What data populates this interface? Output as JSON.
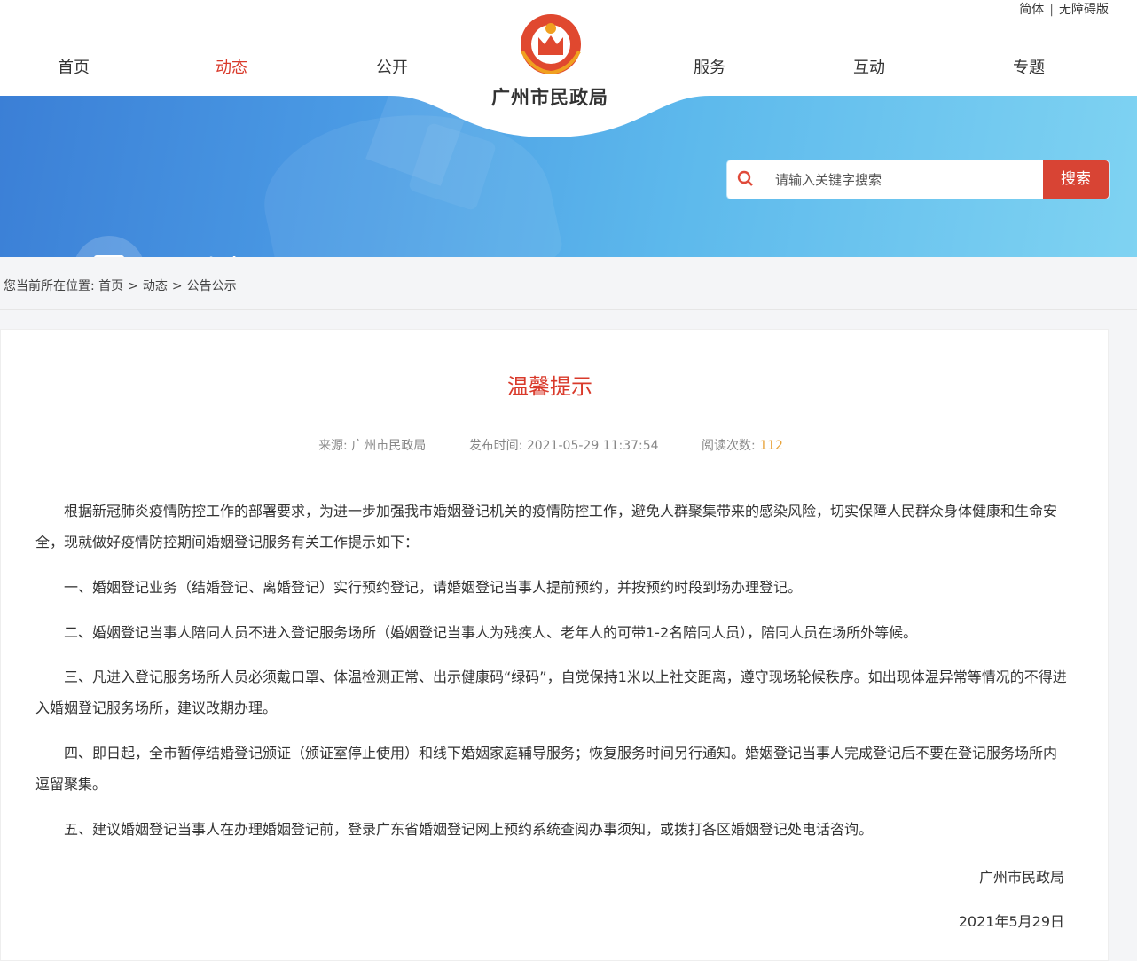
{
  "top_links": {
    "simplified": "简体",
    "accessible": "无障碍版"
  },
  "nav": {
    "items": [
      "首页",
      "动态",
      "公开",
      "服务",
      "互动",
      "专题"
    ],
    "active": 1
  },
  "logo": {
    "title": "广州市民政局"
  },
  "banner": {
    "section_title": "动态"
  },
  "search": {
    "placeholder": "请输入关键字搜索",
    "button": "搜索"
  },
  "breadcrumb": {
    "label": "您当前所在位置:",
    "items": [
      "首页",
      "动态",
      "公告公示"
    ]
  },
  "article": {
    "title": "温馨提示",
    "meta": {
      "source_label": "来源:",
      "source": "广州市民政局",
      "time_label": "发布时间:",
      "time": "2021-05-29 11:37:54",
      "views_label": "阅读次数:",
      "views": "112"
    },
    "paragraphs": [
      "根据新冠肺炎疫情防控工作的部署要求，为进一步加强我市婚姻登记机关的疫情防控工作，避免人群聚集带来的感染风险，切实保障人民群众身体健康和生命安全，现就做好疫情防控期间婚姻登记服务有关工作提示如下：",
      "一、婚姻登记业务（结婚登记、离婚登记）实行预约登记，请婚姻登记当事人提前预约，并按预约时段到场办理登记。",
      "二、婚姻登记当事人陪同人员不进入登记服务场所（婚姻登记当事人为残疾人、老年人的可带1-2名陪同人员），陪同人员在场所外等候。",
      "三、凡进入登记服务场所人员必须戴口罩、体温检测正常、出示健康码“绿码”，自觉保持1米以上社交距离，遵守现场轮候秩序。如出现体温异常等情况的不得进入婚姻登记服务场所，建议改期办理。",
      "四、即日起，全市暂停结婚登记颁证（颁证室停止使用）和线下婚姻家庭辅导服务；恢复服务时间另行通知。婚姻登记当事人完成登记后不要在登记服务场所内逗留聚集。",
      "五、建议婚姻登记当事人在办理婚姻登记前，登录广东省婚姻登记网上预约系统查阅办事须知，或拨打各区婚姻登记处电话咨询。"
    ],
    "signature": "广州市民政局",
    "date": "2021年5月29日"
  },
  "colors": {
    "accent": "#d93a2b",
    "banner": "#4a9ae4",
    "views": "#e8a33b"
  }
}
